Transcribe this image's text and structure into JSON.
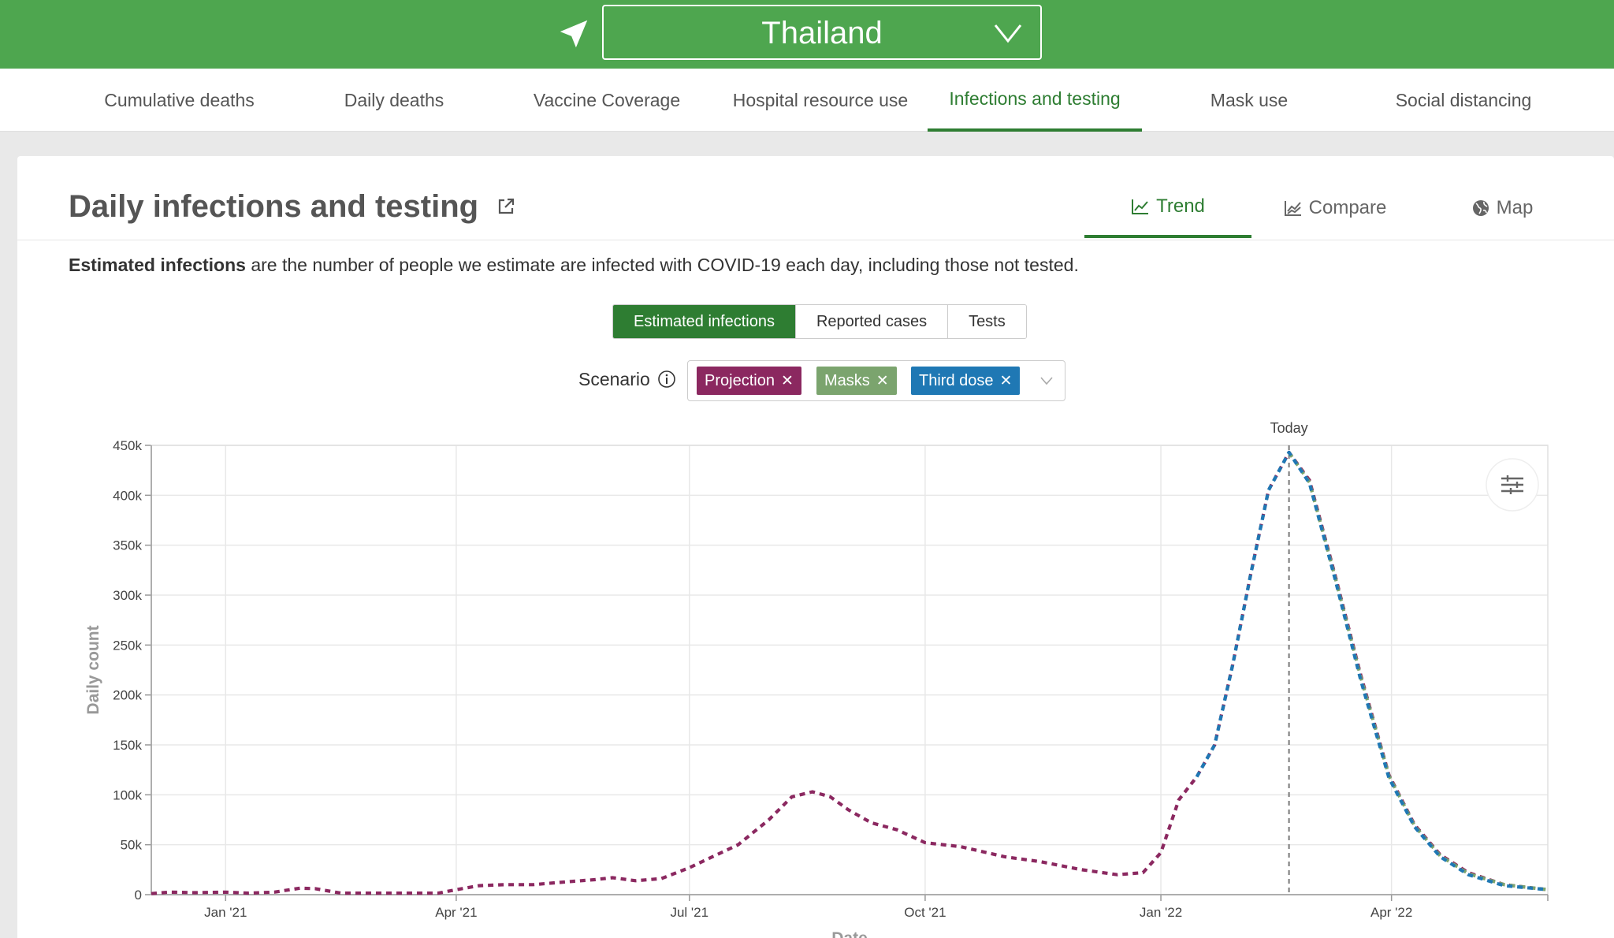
{
  "location": {
    "selected": "Thailand"
  },
  "nav": {
    "tabs": [
      {
        "label": "Cumulative deaths"
      },
      {
        "label": "Daily deaths"
      },
      {
        "label": "Vaccine Coverage"
      },
      {
        "label": "Hospital resource use"
      },
      {
        "label": "Infections and testing"
      },
      {
        "label": "Mask use"
      },
      {
        "label": "Social distancing"
      }
    ],
    "active": "Infections and testing"
  },
  "card": {
    "title": "Daily infections and testing",
    "view_tabs": [
      {
        "label": "Trend"
      },
      {
        "label": "Compare"
      },
      {
        "label": "Map"
      }
    ],
    "active_view": "Trend",
    "description_bold": "Estimated infections",
    "description_rest": " are the number of people we estimate are infected with COVID-19 each day, including those not tested.",
    "metric_options": [
      {
        "label": "Estimated infections"
      },
      {
        "label": "Reported cases"
      },
      {
        "label": "Tests"
      }
    ],
    "selected_metric": "Estimated infections",
    "scenario_label": "Scenario",
    "scenarios": [
      {
        "label": "Projection",
        "color": "#8b2860"
      },
      {
        "label": "Masks",
        "color": "#7ba46e"
      },
      {
        "label": "Third dose",
        "color": "#1f78b4"
      }
    ]
  },
  "colors": {
    "brand": "#4ea64f",
    "accent": "#2e7d32"
  },
  "chart_data": {
    "type": "line",
    "ylabel": "Daily count",
    "xlabel": "Date",
    "today_label": "Today",
    "y_ticks": [
      "0",
      "50k",
      "100k",
      "150k",
      "200k",
      "250k",
      "300k",
      "350k",
      "400k",
      "450k"
    ],
    "ylim": [
      0,
      450000
    ],
    "x_ticks": [
      {
        "label": "Jan '21",
        "date": "2021-01-01"
      },
      {
        "label": "Apr '21",
        "date": "2021-04-01"
      },
      {
        "label": "Jul '21",
        "date": "2021-07-01"
      },
      {
        "label": "Oct '21",
        "date": "2021-10-01"
      },
      {
        "label": "Jan '22",
        "date": "2022-01-01"
      },
      {
        "label": "Apr '22",
        "date": "2022-04-01"
      }
    ],
    "xlim": [
      "2020-12-03",
      "2022-06-01"
    ],
    "today": "2022-02-20",
    "grid": true,
    "series": [
      {
        "name": "Projection",
        "color": "#8b2860",
        "points": [
          [
            "2020-12-03",
            1000
          ],
          [
            "2020-12-10",
            2500
          ],
          [
            "2020-12-20",
            2000
          ],
          [
            "2021-01-01",
            2500
          ],
          [
            "2021-01-10",
            1500
          ],
          [
            "2021-01-20",
            2500
          ],
          [
            "2021-01-30",
            6500
          ],
          [
            "2021-02-05",
            6000
          ],
          [
            "2021-02-15",
            1500
          ],
          [
            "2021-03-01",
            1500
          ],
          [
            "2021-03-15",
            1500
          ],
          [
            "2021-03-25",
            1500
          ],
          [
            "2021-04-01",
            5000
          ],
          [
            "2021-04-10",
            9000
          ],
          [
            "2021-04-20",
            10000
          ],
          [
            "2021-05-01",
            10000
          ],
          [
            "2021-05-15",
            13000
          ],
          [
            "2021-05-25",
            15000
          ],
          [
            "2021-06-01",
            17000
          ],
          [
            "2021-06-10",
            14000
          ],
          [
            "2021-06-20",
            16000
          ],
          [
            "2021-07-01",
            27000
          ],
          [
            "2021-07-10",
            38000
          ],
          [
            "2021-07-20",
            50000
          ],
          [
            "2021-08-01",
            75000
          ],
          [
            "2021-08-10",
            98000
          ],
          [
            "2021-08-18",
            103000
          ],
          [
            "2021-08-25",
            98000
          ],
          [
            "2021-09-01",
            85000
          ],
          [
            "2021-09-10",
            72000
          ],
          [
            "2021-09-20",
            65000
          ],
          [
            "2021-10-01",
            52000
          ],
          [
            "2021-10-15",
            48000
          ],
          [
            "2021-11-01",
            38000
          ],
          [
            "2021-11-15",
            33000
          ],
          [
            "2021-12-01",
            25000
          ],
          [
            "2021-12-15",
            20000
          ],
          [
            "2021-12-25",
            22000
          ],
          [
            "2022-01-01",
            42000
          ],
          [
            "2022-01-08",
            95000
          ],
          [
            "2022-01-15",
            118000
          ],
          [
            "2022-01-22",
            150000
          ],
          [
            "2022-01-29",
            230000
          ],
          [
            "2022-02-05",
            320000
          ],
          [
            "2022-02-12",
            405000
          ],
          [
            "2022-02-20",
            443000
          ],
          [
            "2022-02-28",
            415000
          ],
          [
            "2022-03-10",
            320000
          ],
          [
            "2022-03-20",
            220000
          ],
          [
            "2022-03-31",
            120000
          ],
          [
            "2022-04-10",
            70000
          ],
          [
            "2022-04-20",
            40000
          ],
          [
            "2022-05-01",
            22000
          ],
          [
            "2022-05-15",
            10000
          ],
          [
            "2022-06-01",
            5000
          ]
        ]
      },
      {
        "name": "Masks",
        "color": "#7ba46e",
        "points": [
          [
            "2022-02-20",
            443000
          ],
          [
            "2022-02-28",
            413000
          ],
          [
            "2022-03-10",
            318000
          ],
          [
            "2022-03-20",
            218000
          ],
          [
            "2022-03-31",
            119000
          ],
          [
            "2022-04-10",
            69000
          ],
          [
            "2022-04-20",
            39000
          ],
          [
            "2022-05-01",
            21000
          ],
          [
            "2022-05-15",
            10000
          ],
          [
            "2022-06-01",
            5000
          ]
        ]
      },
      {
        "name": "Third dose",
        "color": "#1f78b4",
        "points": [
          [
            "2022-01-15",
            118000
          ],
          [
            "2022-01-22",
            150000
          ],
          [
            "2022-01-29",
            230000
          ],
          [
            "2022-02-05",
            320000
          ],
          [
            "2022-02-12",
            405000
          ],
          [
            "2022-02-20",
            443000
          ],
          [
            "2022-02-28",
            412000
          ],
          [
            "2022-03-10",
            316000
          ],
          [
            "2022-03-20",
            215000
          ],
          [
            "2022-03-31",
            117000
          ],
          [
            "2022-04-10",
            68000
          ],
          [
            "2022-04-20",
            38000
          ],
          [
            "2022-05-01",
            20000
          ],
          [
            "2022-05-15",
            9000
          ],
          [
            "2022-06-01",
            5000
          ]
        ]
      }
    ]
  }
}
